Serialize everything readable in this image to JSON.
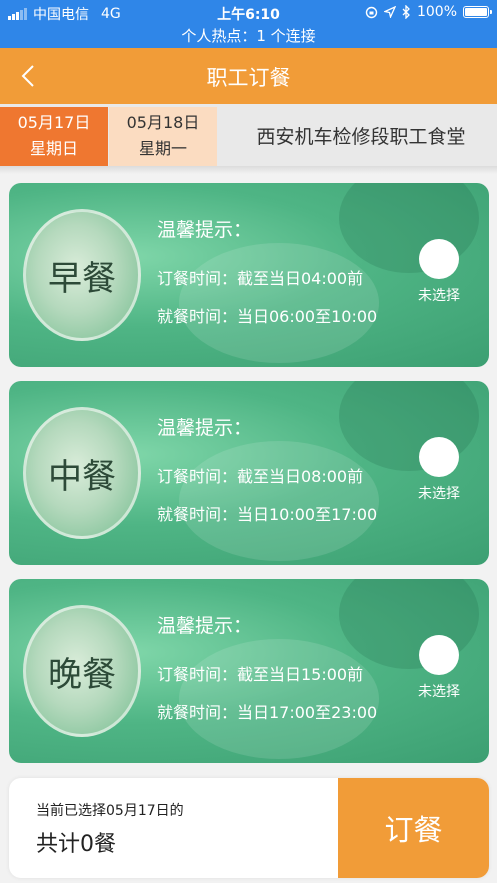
{
  "status_bar": {
    "carrier": "中国电信",
    "network": "4G",
    "time": "上午6:10",
    "battery": "100%",
    "battery_level": 1.0,
    "hotspot": "个人热点：1 个连接"
  },
  "nav": {
    "title": "职工订餐"
  },
  "dates": [
    {
      "date": "05月17日",
      "weekday": "星期日",
      "selected": true
    },
    {
      "date": "05月18日",
      "weekday": "星期一",
      "selected": false
    }
  ],
  "canteen": "西安机车检修段职工食堂",
  "meals": [
    {
      "name": "早餐",
      "tip_title": "温馨提示：",
      "order_time": "订餐时间：截至当日04:00前",
      "meal_time": "就餐时间：当日06:00至10:00",
      "status": "未选择"
    },
    {
      "name": "中餐",
      "tip_title": "温馨提示：",
      "order_time": "订餐时间：截至当日08:00前",
      "meal_time": "就餐时间：当日10:00至17:00",
      "status": "未选择"
    },
    {
      "name": "晚餐",
      "tip_title": "温馨提示：",
      "order_time": "订餐时间：截至当日15:00前",
      "meal_time": "就餐时间：当日17:00至23:00",
      "status": "未选择"
    }
  ],
  "footer": {
    "selection_info": "当前已选择05月17日的",
    "total": "共计0餐",
    "order_button": "订餐"
  },
  "colors": {
    "status_bar": "#2f86e8",
    "accent_orange": "#f19c38",
    "active_date": "#ef7730",
    "inactive_date": "#fbdcc1",
    "card_green": "#4fb585"
  }
}
